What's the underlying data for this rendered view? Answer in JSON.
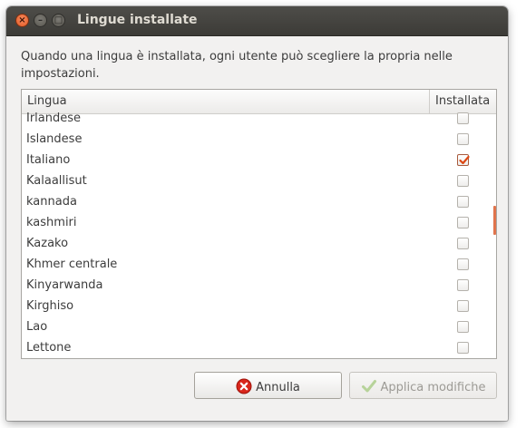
{
  "window": {
    "title": "Lingue installate"
  },
  "description": "Quando una lingua è installata, ogni utente può scegliere la propria nelle impostazioni.",
  "table": {
    "columns": [
      "Lingua",
      "Installata"
    ],
    "rows": [
      {
        "label": "Irlandese",
        "installed": false
      },
      {
        "label": "Islandese",
        "installed": false
      },
      {
        "label": "Italiano",
        "installed": true
      },
      {
        "label": "Kalaallisut",
        "installed": false
      },
      {
        "label": "kannada",
        "installed": false
      },
      {
        "label": "kashmiri",
        "installed": false
      },
      {
        "label": "Kazako",
        "installed": false
      },
      {
        "label": "Khmer centrale",
        "installed": false
      },
      {
        "label": "Kinyarwanda",
        "installed": false
      },
      {
        "label": "Kirghiso",
        "installed": false
      },
      {
        "label": "Lao",
        "installed": false
      },
      {
        "label": "Lettone",
        "installed": false
      }
    ]
  },
  "buttons": {
    "cancel": {
      "label": "Annulla",
      "icon": "cancel-icon"
    },
    "apply": {
      "label": "Applica modifiche",
      "icon": "checkmark-icon",
      "enabled": false
    }
  },
  "colors": {
    "accent": "#dd4814",
    "titlebar": "#3c3b37"
  }
}
